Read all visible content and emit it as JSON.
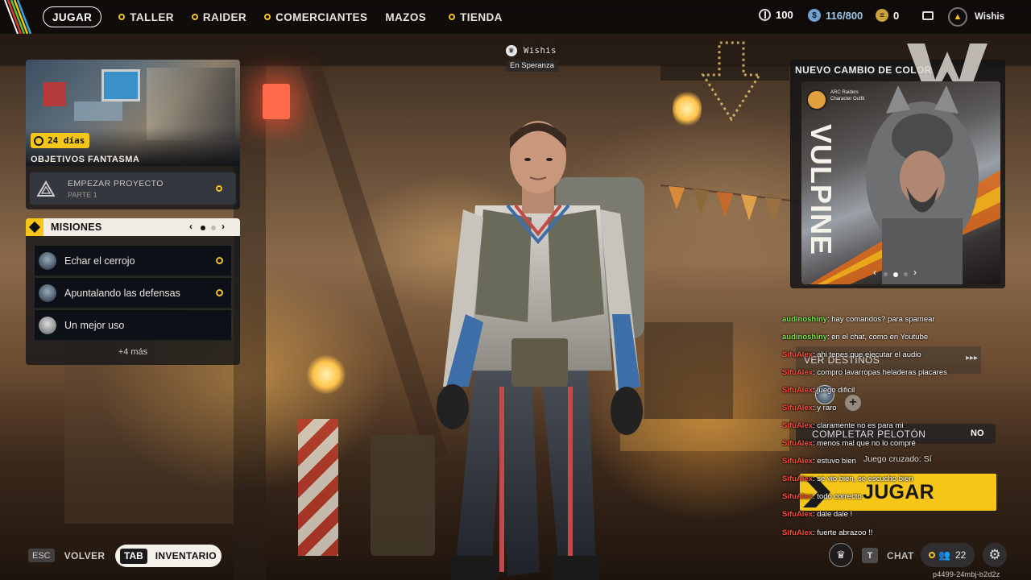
{
  "nav": {
    "items": [
      {
        "label": "JUGAR",
        "active": true,
        "dot": false
      },
      {
        "label": "TALLER",
        "active": false,
        "dot": true
      },
      {
        "label": "RAIDER",
        "active": false,
        "dot": true
      },
      {
        "label": "COMERCIANTES",
        "active": false,
        "dot": true
      },
      {
        "label": "MAZOS",
        "active": false,
        "dot": false
      },
      {
        "label": "TIENDA",
        "active": false,
        "dot": true
      }
    ]
  },
  "currencies": {
    "coins": "100",
    "cred": "116/800",
    "tokens": "0"
  },
  "user": {
    "name": "Wishis"
  },
  "player_tag": {
    "name": "Wishis",
    "location": "En Speranza"
  },
  "ghost": {
    "days": "24 días",
    "title": "OBJETIVOS FANTASMA",
    "project_title": "EMPEZAR PROYECTO",
    "project_part": "PARTE 1"
  },
  "missions": {
    "title": "MISIONES",
    "items": [
      "Echar el cerrojo",
      "Apuntalando las defensas",
      "Un mejor uso"
    ],
    "more": "+4 más"
  },
  "promo": {
    "title": "NUEVO CAMBIO DE COLOR",
    "brand_line1": "ARC Raiders",
    "brand_line2": "Character Outfit",
    "name": "VULPINE"
  },
  "chat": [
    {
      "user": "audinoshiny",
      "msg": "hay comandos? para spamear",
      "color": "green"
    },
    {
      "user": "audinoshiny",
      "msg": "en el chat, como en Youtube",
      "color": "green"
    },
    {
      "user": "SifuAlex",
      "msg": "ahi tenes que ejecutar el audio",
      "color": "red"
    },
    {
      "user": "SifuAlex",
      "msg": "compro lavarropas heladeras placares",
      "color": "red"
    },
    {
      "user": "SifuAlex",
      "msg": "juego dificil",
      "color": "red"
    },
    {
      "user": "SifuAlex",
      "msg": "y raro",
      "color": "red"
    },
    {
      "user": "SifuAlex",
      "msg": "claramente no es para mi",
      "color": "red"
    },
    {
      "user": "SifuAlex",
      "msg": "menos mal que no lo compré",
      "color": "red"
    },
    {
      "user": "SifuAlex",
      "msg": "estuvo bien",
      "color": "red"
    },
    {
      "user": "SifuAlex",
      "msg": "se vio bien, se escucho bien",
      "color": "red"
    },
    {
      "user": "SifuAlex",
      "msg": "todo correcto",
      "color": "red"
    },
    {
      "user": "SifuAlex",
      "msg": "dale dale !",
      "color": "red"
    },
    {
      "user": "SifuAlex",
      "msg": "fuerte abrazoo !!",
      "color": "red"
    }
  ],
  "right_menu": {
    "destinations": "VER DESTINOS",
    "squad_label": "COMPLETAR PELOTÓN",
    "squad_value": "NO",
    "crossplay": "Juego cruzado: Sí",
    "play": "JUGAR"
  },
  "bottom": {
    "esc_key": "ESC",
    "esc_label": "VOLVER",
    "tab_key": "TAB",
    "tab_label": "INVENTARIO",
    "chat_key": "T",
    "chat_label": "CHAT",
    "friends_count": "22",
    "build_id": "p4499-24mbj-b2d2z"
  },
  "colors": {
    "accent": "#f5c518",
    "chat_red": "#ff4a3a",
    "chat_green": "#7ee04a"
  }
}
